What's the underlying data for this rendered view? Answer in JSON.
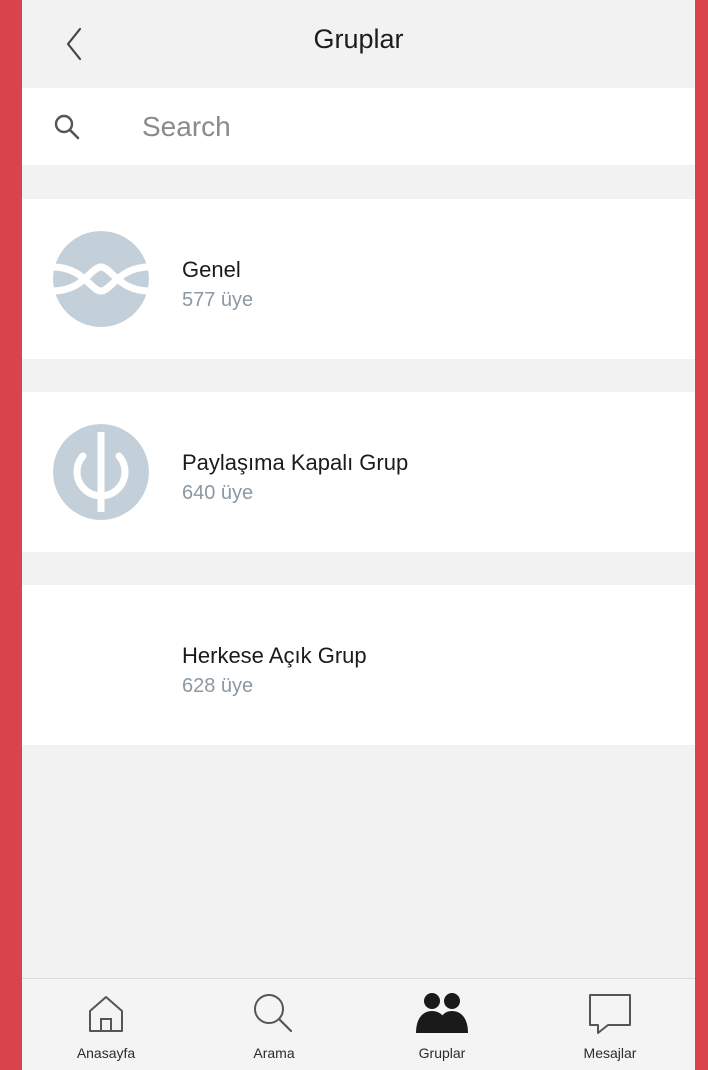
{
  "header": {
    "title": "Gruplar",
    "back_icon": "chevron-left-icon"
  },
  "search": {
    "placeholder": "Search",
    "value": "",
    "icon": "search-icon"
  },
  "groups": [
    {
      "name": "Genel",
      "members": "577 üye",
      "avatar": "genel-logo"
    },
    {
      "name": "Paylaşıma Kapalı Grup",
      "members": "640 üye",
      "avatar": "power-logo"
    },
    {
      "name": "Herkese Açık Grup",
      "members": "628 üye",
      "avatar": ""
    }
  ],
  "tabbar": {
    "items": [
      {
        "label": "Anasayfa",
        "icon": "home-icon",
        "active": false
      },
      {
        "label": "Arama",
        "icon": "search-icon",
        "active": false
      },
      {
        "label": "Gruplar",
        "icon": "groups-icon",
        "active": true
      },
      {
        "label": "Mesajlar",
        "icon": "message-icon",
        "active": false
      }
    ]
  },
  "colors": {
    "frame": "#d9434c",
    "background": "#f2f2f2",
    "card": "#ffffff",
    "avatar": "#c3d0d9",
    "member_count": "#8c98a2"
  }
}
